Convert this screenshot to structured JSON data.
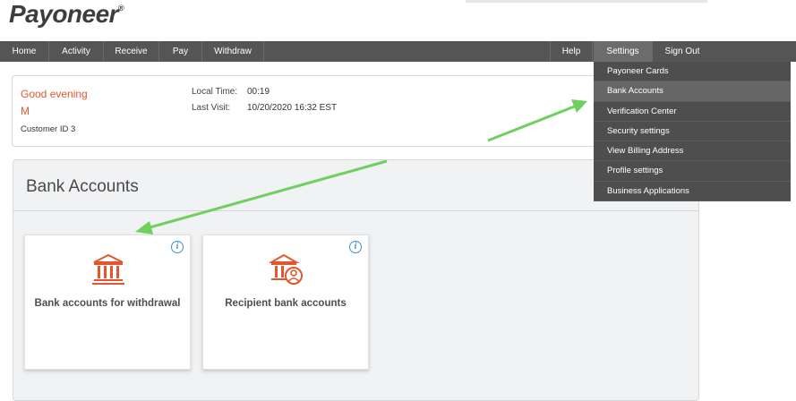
{
  "brand": {
    "logo_text": "Payoneer",
    "registered_mark": "®",
    "accent_color": "#e4572e",
    "nav_color": "#555555"
  },
  "nav": {
    "home": "Home",
    "activity": "Activity",
    "receive": "Receive",
    "pay": "Pay",
    "withdraw": "Withdraw",
    "help": "Help",
    "settings": "Settings",
    "sign_out": "Sign Out"
  },
  "settings_menu": {
    "items": [
      "Payoneer Cards",
      "Bank Accounts",
      "Verification Center",
      "Security settings",
      "View Billing Address",
      "Profile settings",
      "Business Applications"
    ]
  },
  "greeting": {
    "text": "Good evening",
    "name_initial": "M",
    "customer_id_label": "Customer ID",
    "customer_id_partial": "3"
  },
  "session": {
    "local_time_label": "Local Time:",
    "local_time_value": "00:19",
    "last_visit_label": "Last Visit:",
    "last_visit_value": "10/20/2020 16:32 EST"
  },
  "bank_accounts": {
    "title": "Bank Accounts",
    "cards": [
      {
        "label": "Bank accounts for withdrawal",
        "icon": "bank-icon"
      },
      {
        "label": "Recipient bank accounts",
        "icon": "bank-person-icon"
      }
    ],
    "info_glyph": "i"
  },
  "annotation_color": "#6fcf5f"
}
